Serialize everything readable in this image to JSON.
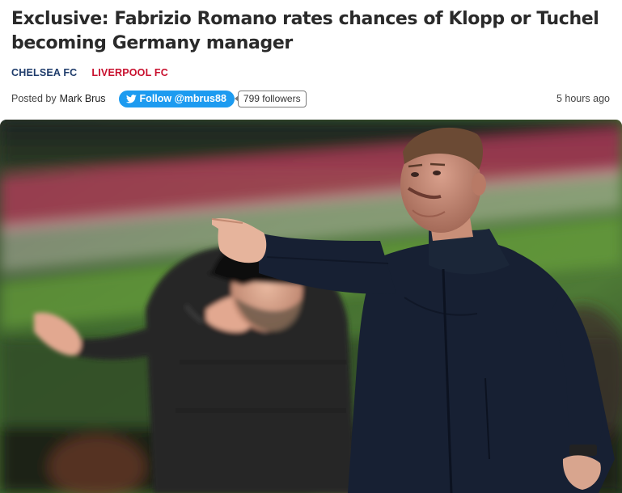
{
  "article": {
    "headline": "Exclusive: Fabrizio Romano rates chances of Klopp or Tuchel becoming Germany manager",
    "tags": [
      {
        "label": "CHELSEA FC",
        "color": "#1f3c6b"
      },
      {
        "label": "LIVERPOOL FC",
        "color": "#c8102e"
      }
    ],
    "byline": {
      "posted_label": "Posted by",
      "author": "Mark Brus",
      "follow_label": "Follow @mbrus88",
      "follow_icon": "twitter-bird-icon",
      "followers": "799 followers",
      "timestamp": "5 hours ago"
    },
    "image": {
      "subject": "Tuchel and Klopp gesturing on the touchline"
    }
  },
  "colors": {
    "twitter_blue": "#1d9bf0",
    "headline": "#2a2a2a"
  }
}
